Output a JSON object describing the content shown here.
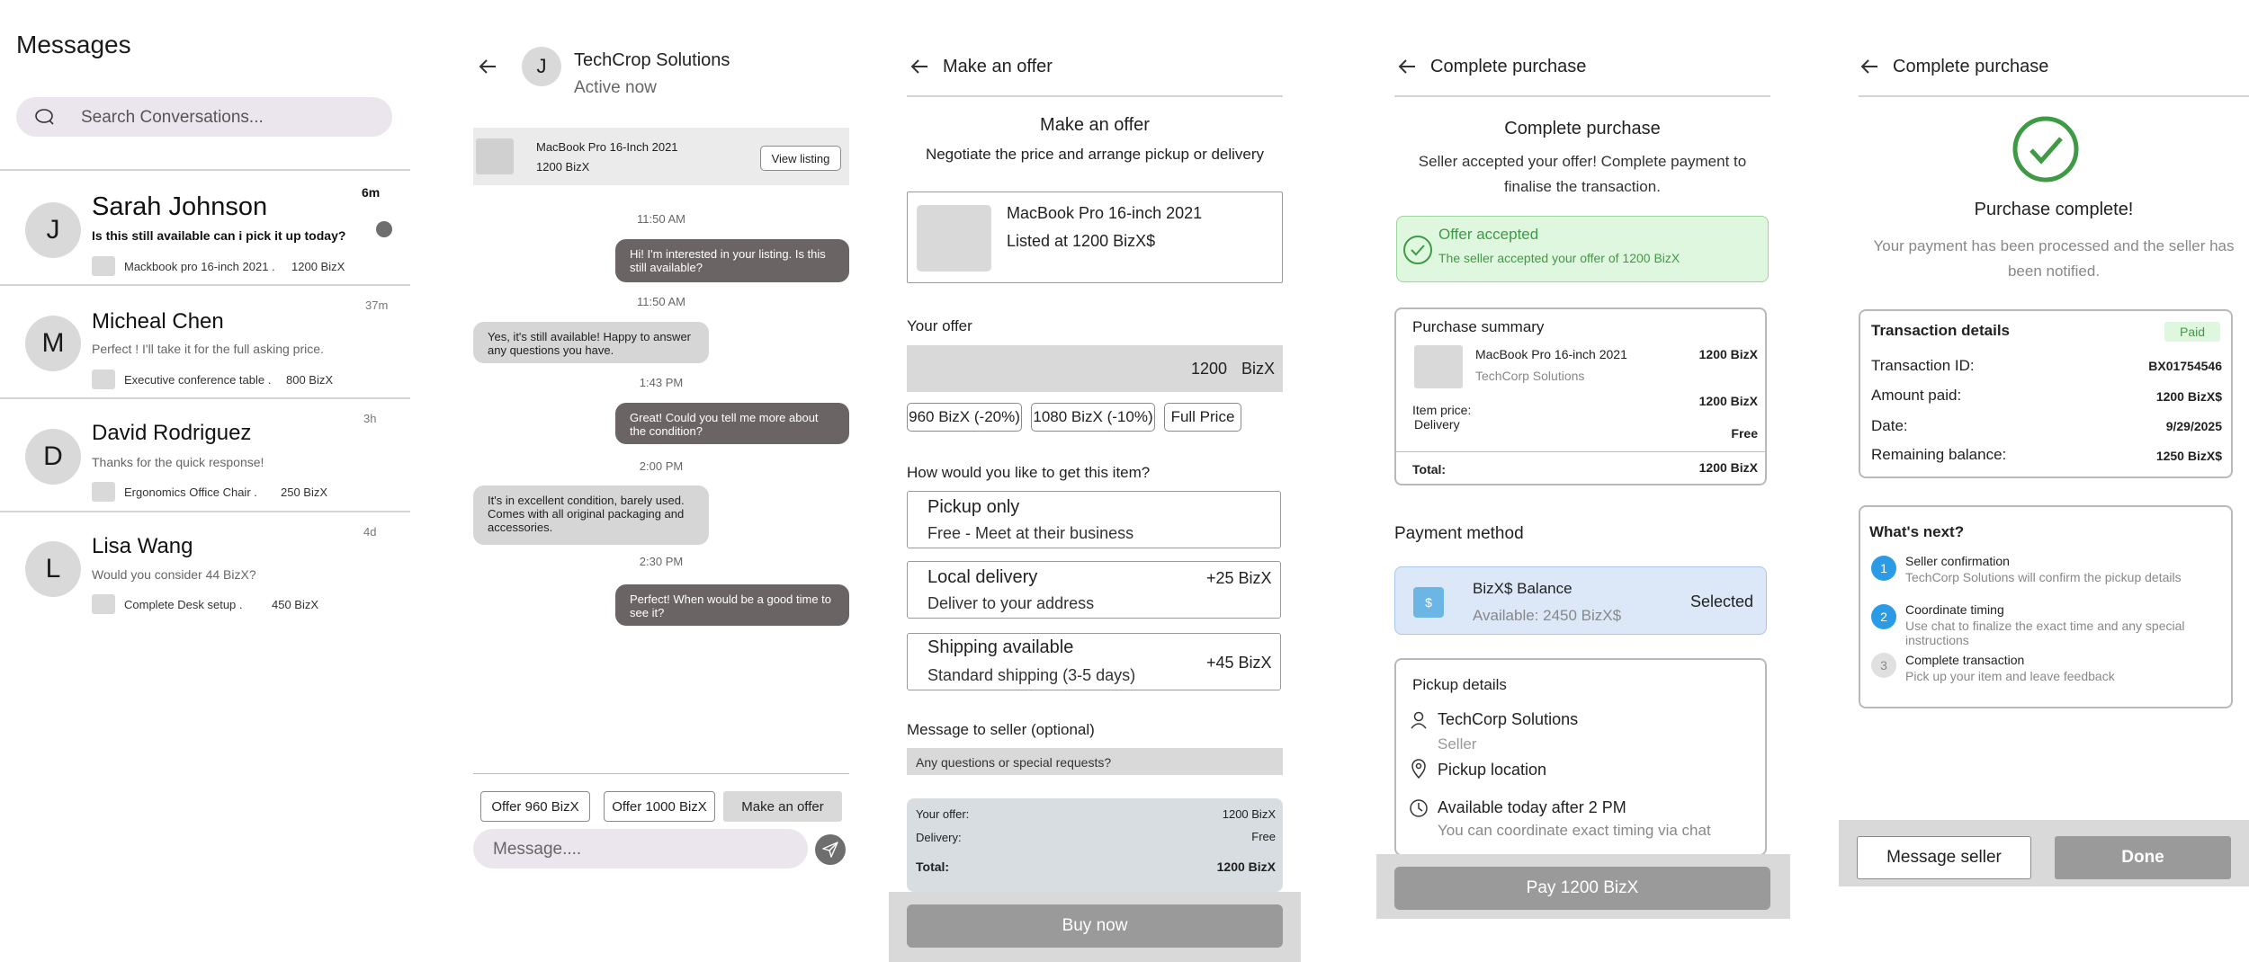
{
  "messages_screen": {
    "title": "Messages",
    "search_placeholder": "Search Conversations...",
    "conversations": [
      {
        "initial": "J",
        "name": "Sarah Johnson",
        "time": "6m",
        "preview": "Is this still available can i pick it up today?",
        "item": "Mackbook pro 16-inch 2021 .",
        "price": "1200 BizX",
        "unread": true
      },
      {
        "initial": "M",
        "name": "Micheal Chen",
        "time": "37m",
        "preview": "Perfect ! I'll take it for the full asking price.",
        "item": "Executive conference table .",
        "price": "800 BizX",
        "unread": false
      },
      {
        "initial": "D",
        "name": "David Rodriguez",
        "time": "3h",
        "preview": "Thanks for the quick response!",
        "item": "Ergonomics Office Chair .",
        "price": "250 BizX",
        "unread": false
      },
      {
        "initial": "L",
        "name": "Lisa Wang",
        "time": "4d",
        "preview": "Would you consider 44 BizX?",
        "item": "Complete Desk setup .",
        "price": "450 BizX",
        "unread": false
      }
    ]
  },
  "chat_screen": {
    "contact_initial": "J",
    "contact_name": "TechCrop Solutions",
    "status": "Active now",
    "listing_title": "MacBook Pro 16-Inch 2021",
    "listing_price": "1200 BizX",
    "view_listing": "View listing",
    "messages": [
      {
        "time": "11:50 AM",
        "text": "Hi! I'm interested in your listing. Is this still available?",
        "dir": "out"
      },
      {
        "time": "11:50 AM",
        "text": "Yes, it's still available! Happy to answer any questions you have.",
        "dir": "in"
      },
      {
        "time": "1:43 PM",
        "text": "Great! Could you tell me more about the condition?",
        "dir": "out"
      },
      {
        "time": "2:00 PM",
        "text": "It's in excellent condition, barely used. Comes with all original packaging and accessories.",
        "dir": "in"
      },
      {
        "time": "2:30 PM",
        "text": "Perfect! When would be a good time to see it?",
        "dir": "out"
      }
    ],
    "quick_offer_1": "Offer 960 BizX",
    "quick_offer_2": "Offer 1000 BizX",
    "make_offer": "Make an offer",
    "message_placeholder": "Message...."
  },
  "offer_screen": {
    "header": "Make an offer",
    "heading": "Make an offer",
    "subheading": "Negotiate the price and arrange pickup or delivery",
    "product_title": "MacBook Pro 16-inch 2021",
    "product_price": "Listed at 1200 BizX$",
    "your_offer_label": "Your offer",
    "offer_value": "1200",
    "offer_currency": "BizX",
    "chip_1": "960 BizX (-20%)",
    "chip_2": "1080 BizX (-10%)",
    "chip_3": "Full Price",
    "delivery_question": "How would you like to get this item?",
    "options": [
      {
        "title": "Pickup only",
        "sub": "Free - Meet at their business",
        "price": ""
      },
      {
        "title": "Local delivery",
        "sub": "Deliver to your address",
        "price": "+25 BizX"
      },
      {
        "title": "Shipping available",
        "sub": "Standard shipping (3-5 days)",
        "price": "+45 BizX"
      }
    ],
    "message_label": "Message to seller (optional)",
    "message_placeholder": "Any questions or special requests?",
    "summary_offer_label": "Your offer:",
    "summary_offer_value": "1200 BizX",
    "summary_delivery_label": "Delivery:",
    "summary_delivery_value": "Free",
    "summary_total_label": "Total:",
    "summary_total_value": "1200 BizX",
    "buy_now": "Buy now"
  },
  "purchase_screen": {
    "header": "Complete purchase",
    "heading": "Complete purchase",
    "description": "Seller accepted your offer! Complete payment to finalise the transaction.",
    "accepted_title": "Offer accepted",
    "accepted_sub": "The seller accepted your offer of 1200 BizX",
    "summary_title": "Purchase summary",
    "item_title": "MacBook Pro 16-inch 2021",
    "item_seller": "TechCorp Solutions",
    "item_price": "1200 BizX",
    "item_price_label": "Item price:",
    "item_price_value": "1200 BizX",
    "delivery_label": "Delivery",
    "delivery_value": "Free",
    "total_label": "Total:",
    "total_value": "1200 BizX",
    "payment_method_label": "Payment method",
    "balance_title": "BizX$ Balance",
    "balance_available": "Available: 2450 BizX$",
    "selected": "Selected",
    "wallet_glyph": "$",
    "pickup_title": "Pickup details",
    "seller_name": "TechCorp Solutions",
    "seller_role": "Seller",
    "pickup_location": "Pickup location",
    "availability": "Available today after 2 PM",
    "availability_sub": "You can coordinate exact timing via chat",
    "pay_button": "Pay 1200 BizX"
  },
  "complete_screen": {
    "header": "Complete purchase",
    "title": "Purchase complete!",
    "description": "Your payment has been processed and the seller has been notified.",
    "details_title": "Transaction details",
    "paid_badge": "Paid",
    "rows": [
      {
        "label": "Transaction ID:",
        "value": "BX01754546"
      },
      {
        "label": "Amount paid:",
        "value": "1200 BizX$"
      },
      {
        "label": "Date:",
        "value": "9/29/2025"
      },
      {
        "label": "Remaining balance:",
        "value": "1250 BizX$"
      }
    ],
    "next_title": "What's next?",
    "steps": [
      {
        "num": "1",
        "title": "Seller confirmation",
        "sub": "TechCorp Solutions will confirm the pickup details"
      },
      {
        "num": "2",
        "title": "Coordinate timing",
        "sub": "Use chat to finalize the exact time and any special instructions"
      },
      {
        "num": "3",
        "title": "Complete transaction",
        "sub": "Pick up your item and leave feedback"
      }
    ],
    "message_seller": "Message seller",
    "done": "Done"
  },
  "colors": {
    "accent_blue": "#2c9be6",
    "success_green": "#3f9a45",
    "success_bg": "#dff7df",
    "selected_bg": "#dce8f7",
    "bubble_out": "#6b6464",
    "bubble_in": "#d6d6d6",
    "button_gray": "#9a9a9a"
  }
}
